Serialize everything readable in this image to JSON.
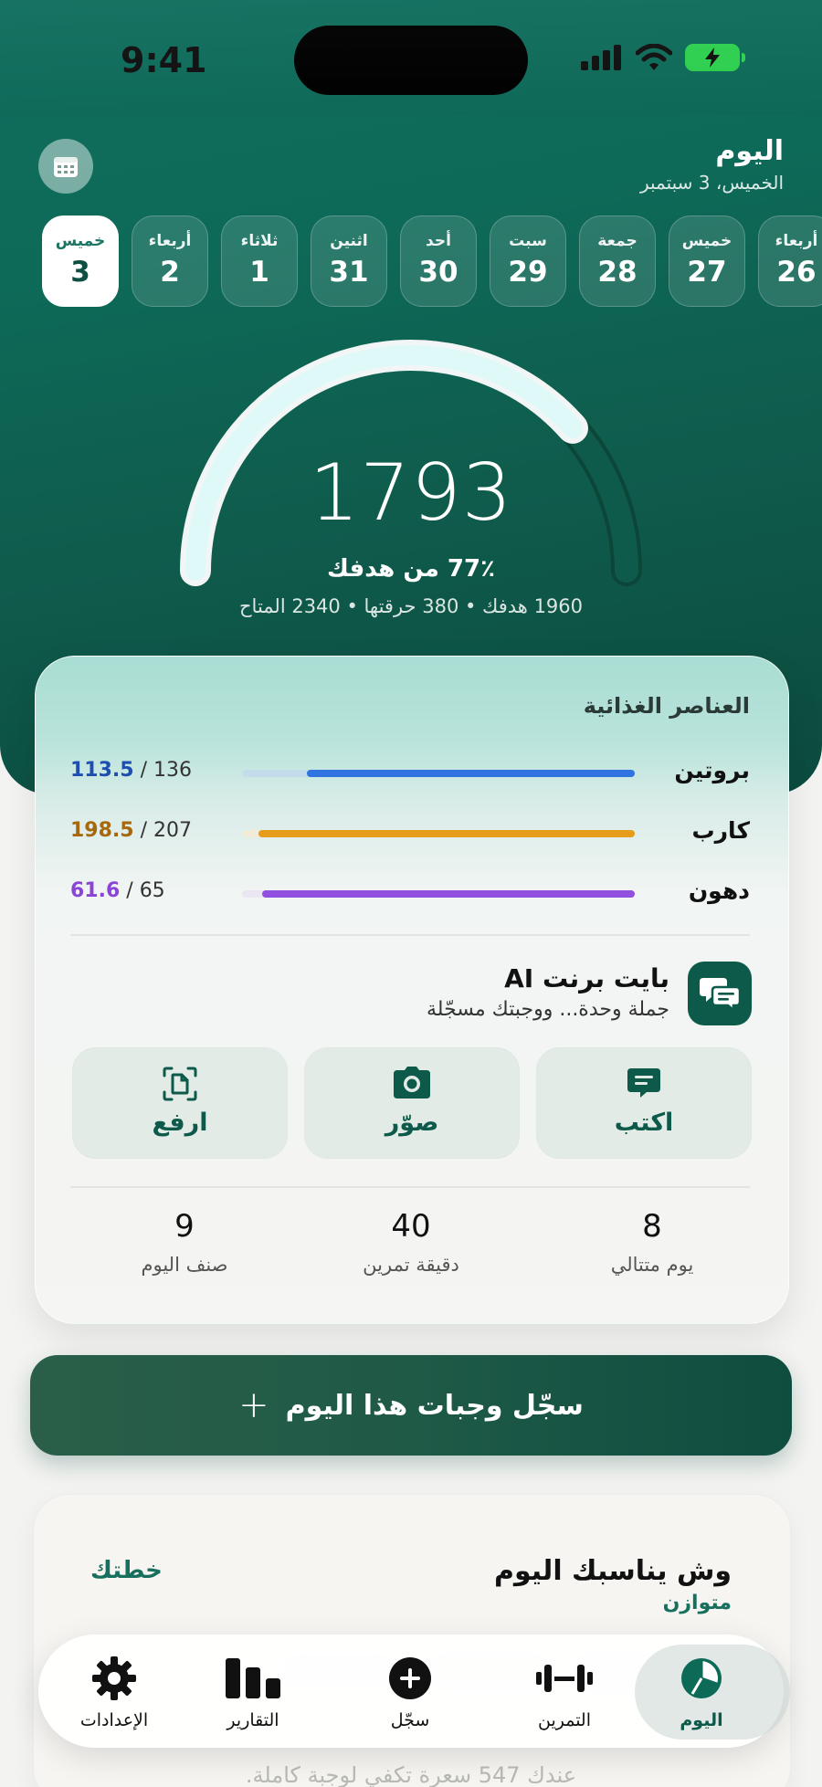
{
  "status": {
    "time": "9:41"
  },
  "header": {
    "title": "اليوم",
    "date": "الخميس، 3 سبتمبر"
  },
  "days": [
    {
      "name": "خميس",
      "num": "3",
      "active": true
    },
    {
      "name": "أربعاء",
      "num": "2"
    },
    {
      "name": "ثلاثاء",
      "num": "1"
    },
    {
      "name": "اثنين",
      "num": "31"
    },
    {
      "name": "أحد",
      "num": "30"
    },
    {
      "name": "سبت",
      "num": "29"
    },
    {
      "name": "جمعة",
      "num": "28"
    },
    {
      "name": "خميس",
      "num": "27"
    },
    {
      "name": "أربعاء",
      "num": "26"
    }
  ],
  "gauge": {
    "value": "1793",
    "percent_text": "77٪ من هدفك",
    "progress": 0.77,
    "stats": "1960 هدفك • 380 حرقتها • 2340 المتاح"
  },
  "nutrients": {
    "title": "العناصر الغذائية",
    "items": [
      {
        "name": "بروتين",
        "current": "113.5",
        "target": "136",
        "color": "#2f74e0",
        "track": "#c2dcec",
        "progress": 0.834,
        "val_color": "#1e4fb0"
      },
      {
        "name": "كارب",
        "current": "198.5",
        "target": "207",
        "color": "#e89c1c",
        "track": "#f1ecd8",
        "progress": 0.959,
        "val_color": "#a6680d"
      },
      {
        "name": "دهون",
        "current": "61.6",
        "target": "65",
        "color": "#9250e0",
        "track": "#ece6f3",
        "progress": 0.948,
        "val_color": "#8a44d6"
      }
    ]
  },
  "ai": {
    "title": "بايت برنت AI",
    "subtitle": "جملة وحدة... ووجبتك مسجّلة",
    "actions": [
      {
        "label": "اكتب",
        "icon": "chat-icon"
      },
      {
        "label": "صوّر",
        "icon": "camera-icon"
      },
      {
        "label": "ارفع",
        "icon": "document-scan-icon"
      }
    ]
  },
  "stats": [
    {
      "value": "8",
      "label": "يوم متتالي"
    },
    {
      "value": "40",
      "label": "دقيقة تمرين"
    },
    {
      "value": "9",
      "label": "صنف اليوم"
    }
  ],
  "cta": {
    "label": "سجّل وجبات هذا اليوم",
    "plus": "+"
  },
  "plan": {
    "title": "وش يناسبك اليوم",
    "subtitle": "متوازن",
    "link": "خطتك",
    "peek_text": "عندك 547 سعرة تكفي لوجبة كاملة."
  },
  "tabs": [
    {
      "label": "اليوم",
      "icon": "pie-chart-icon",
      "active": true
    },
    {
      "label": "التمرين",
      "icon": "dumbbell-icon"
    },
    {
      "label": "سجّل",
      "icon": "plus-circle-icon"
    },
    {
      "label": "التقارير",
      "icon": "bar-chart-icon"
    },
    {
      "label": "الإعدادات",
      "icon": "gear-icon"
    }
  ]
}
